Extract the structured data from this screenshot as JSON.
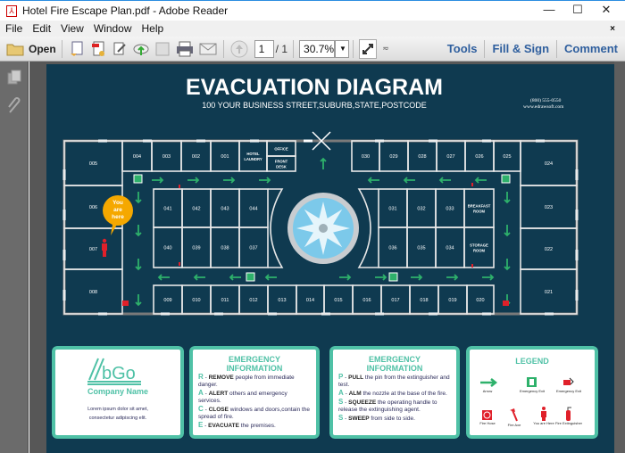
{
  "window": {
    "title": "Hotel Fire Escape Plan.pdf - Adobe Reader",
    "minimize": "—",
    "maximize": "☐",
    "close": "✕"
  },
  "menu": [
    "File",
    "Edit",
    "View",
    "Window",
    "Help"
  ],
  "menu_close": "×",
  "toolbar": {
    "open": "Open",
    "page_current": "1",
    "page_total": "/ 1",
    "zoom": "30.7%",
    "tools": "Tools",
    "fill_sign": "Fill & Sign",
    "comment": "Comment"
  },
  "doc": {
    "title": "EVACUATION DIAGRAM",
    "address": "100 YOUR BUSINESS STREET,SUBURB,STATE,POSTCODE",
    "phone": "(800) 555-0550",
    "website": "www.edrawsoft.com",
    "you_are_here": "You are here",
    "rooms": {
      "left": [
        "005",
        "006",
        "007",
        "008"
      ],
      "top_left": [
        "004",
        "003",
        "002",
        "001",
        "HOTEL LAUNDRY"
      ],
      "office": "OFFICE",
      "front_desk": "FRONT DESK",
      "top_right": [
        "030",
        "029",
        "028",
        "027",
        "026",
        "025"
      ],
      "right": [
        "024",
        "023",
        "022",
        "021"
      ],
      "bottom": [
        "009",
        "010",
        "011",
        "012",
        "013",
        "014",
        "015",
        "016",
        "017",
        "018",
        "019",
        "020"
      ],
      "inner_left_top": [
        "041",
        "042",
        "043",
        "044"
      ],
      "inner_left_bottom": [
        "040",
        "039",
        "038",
        "037"
      ],
      "inner_right_top": [
        "031",
        "032",
        "033",
        "BREAKFAST ROOM"
      ],
      "inner_right_bottom": [
        "036",
        "035",
        "034",
        "STORAGE ROOM"
      ]
    },
    "company": {
      "logo": "bGo",
      "name": "Company Name",
      "text": "Lorem ipsum dolor sit amet, consectetur adipiscing elit."
    },
    "race": {
      "title": "EMERGENCY INFORMATION",
      "items": [
        {
          "l": "R",
          "k": "REMOVE",
          "t": "people from immediate danger."
        },
        {
          "l": "A",
          "k": "ALERT",
          "t": "others and emergency services."
        },
        {
          "l": "C",
          "k": "CLOSE",
          "t": "windows and doors,contain the spread of fire."
        },
        {
          "l": "E",
          "k": "EVACUATE",
          "t": "the premises."
        }
      ]
    },
    "pass": {
      "title": "EMERGENCY INFORMATION",
      "items": [
        {
          "l": "P",
          "k": "PULL",
          "t": "the pin from the extinguisher and test."
        },
        {
          "l": "A",
          "k": "ALM",
          "t": "the nozzle at the base of the fire."
        },
        {
          "l": "S",
          "k": "SQUEEZE",
          "t": "the operating handle to release the extinguishing agent."
        },
        {
          "l": "S",
          "k": "SWEEP",
          "t": "from side to side."
        }
      ]
    },
    "legend": {
      "title": "LEGEND",
      "items": [
        "Arrow",
        "Emergency Exit",
        "Emergency Exit",
        "Fire Hose",
        "Fire Axe",
        "You are Here",
        "Fire Extinguisher"
      ]
    }
  },
  "colors": {
    "page": "#0f3a50",
    "accent": "#4fc1a6",
    "arrow": "#2eb16b",
    "alert": "#e0202a",
    "bubble": "#f5a800"
  }
}
